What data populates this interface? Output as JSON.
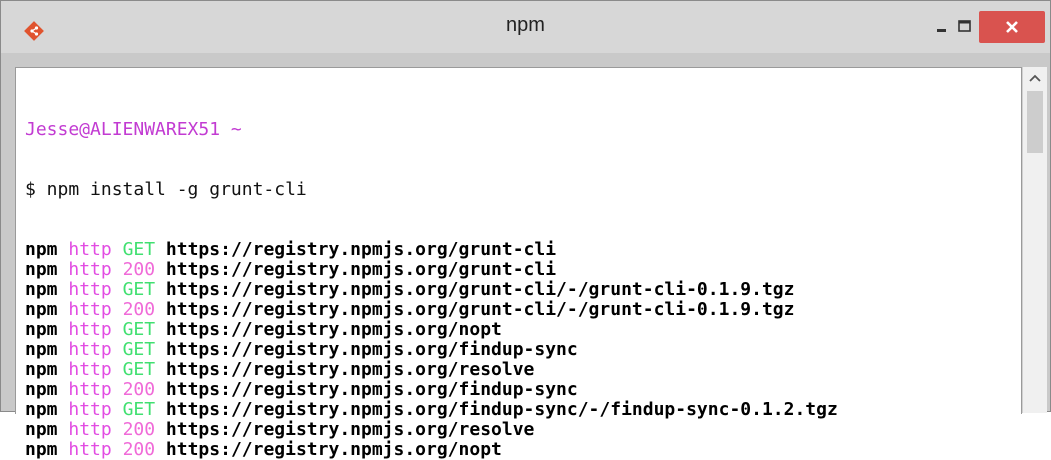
{
  "window": {
    "title": "npm",
    "icon": "git-diamond-icon",
    "controls": {
      "minimize": "–",
      "maximize": "□",
      "close": "✕"
    },
    "close_color": "#d9534f"
  },
  "terminal": {
    "prompt_user": "Jesse@ALIENWAREX51",
    "prompt_path": "~",
    "command": "$ npm install -g grunt-cli",
    "log": [
      {
        "prefix": "npm",
        "proto": "http",
        "status": "GET",
        "url": "https://registry.npmjs.org/grunt-cli"
      },
      {
        "prefix": "npm",
        "proto": "http",
        "status": "200",
        "url": "https://registry.npmjs.org/grunt-cli"
      },
      {
        "prefix": "npm",
        "proto": "http",
        "status": "GET",
        "url": "https://registry.npmjs.org/grunt-cli/-/grunt-cli-0.1.9.tgz"
      },
      {
        "prefix": "npm",
        "proto": "http",
        "status": "200",
        "url": "https://registry.npmjs.org/grunt-cli/-/grunt-cli-0.1.9.tgz"
      },
      {
        "prefix": "npm",
        "proto": "http",
        "status": "GET",
        "url": "https://registry.npmjs.org/nopt"
      },
      {
        "prefix": "npm",
        "proto": "http",
        "status": "GET",
        "url": "https://registry.npmjs.org/findup-sync"
      },
      {
        "prefix": "npm",
        "proto": "http",
        "status": "GET",
        "url": "https://registry.npmjs.org/resolve"
      },
      {
        "prefix": "npm",
        "proto": "http",
        "status": "200",
        "url": "https://registry.npmjs.org/findup-sync"
      },
      {
        "prefix": "npm",
        "proto": "http",
        "status": "GET",
        "url": "https://registry.npmjs.org/findup-sync/-/findup-sync-0.1.2.tgz"
      },
      {
        "prefix": "npm",
        "proto": "http",
        "status": "200",
        "url": "https://registry.npmjs.org/resolve"
      },
      {
        "prefix": "npm",
        "proto": "http",
        "status": "200",
        "url": "https://registry.npmjs.org/nopt"
      }
    ]
  }
}
